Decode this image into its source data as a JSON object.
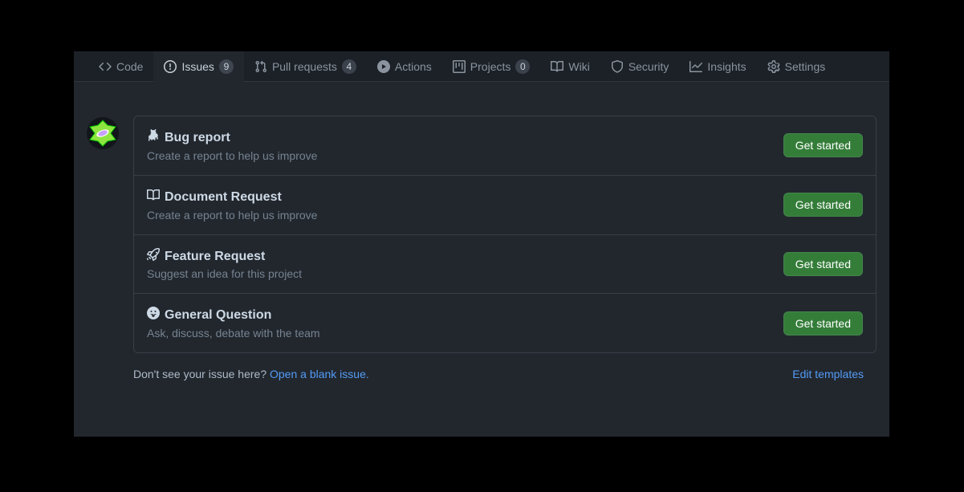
{
  "tabs": {
    "code": "Code",
    "issues": "Issues",
    "issues_count": "9",
    "pulls": "Pull requests",
    "pulls_count": "4",
    "actions": "Actions",
    "projects": "Projects",
    "projects_count": "0",
    "wiki": "Wiki",
    "security": "Security",
    "insights": "Insights",
    "settings": "Settings"
  },
  "templates": [
    {
      "title": "Bug report",
      "desc": "Create a report to help us improve",
      "button": "Get started"
    },
    {
      "title": "Document Request",
      "desc": "Create a report to help us improve",
      "button": "Get started"
    },
    {
      "title": "Feature Request",
      "desc": "Suggest an idea for this project",
      "button": "Get started"
    },
    {
      "title": "General Question",
      "desc": "Ask, discuss, debate with the team",
      "button": "Get started"
    }
  ],
  "footer": {
    "prompt": "Don't see your issue here? ",
    "blank_link": "Open a blank issue.",
    "edit_link": "Edit templates"
  }
}
